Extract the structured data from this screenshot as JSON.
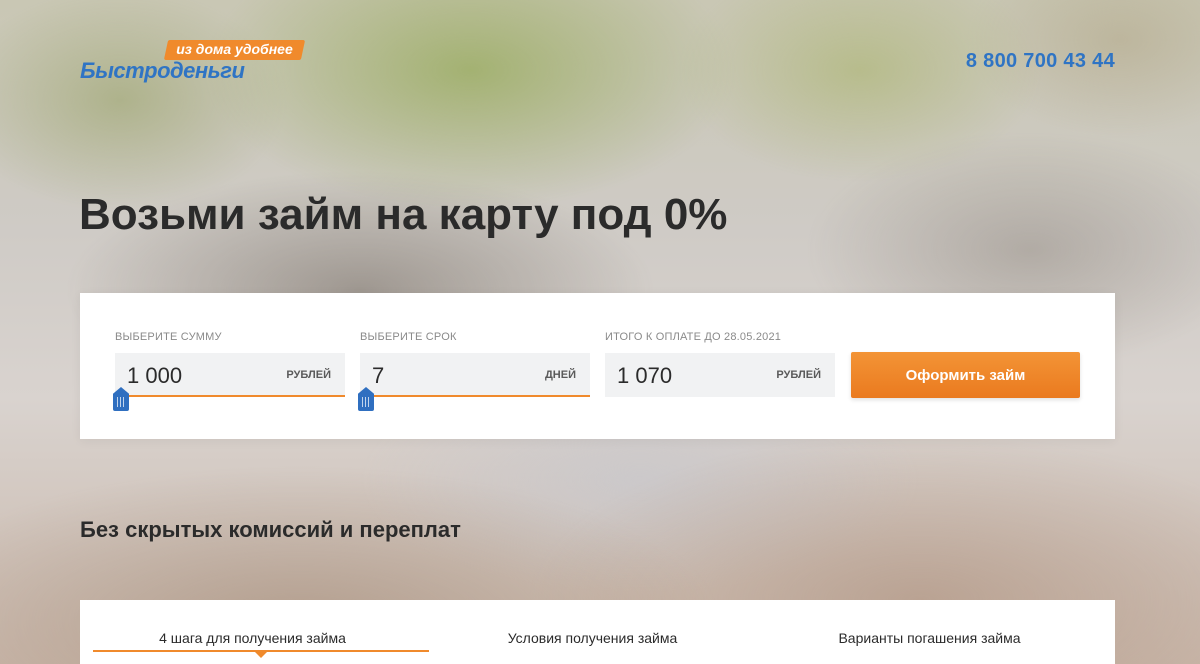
{
  "header": {
    "logo_tagline": "из дома удобнее",
    "logo_name": "Быстроденьги",
    "phone": "8 800 700 43 44"
  },
  "hero": {
    "title": "Возьми займ на карту под 0%"
  },
  "calculator": {
    "amount": {
      "label": "ВЫБЕРИТЕ СУММУ",
      "value": "1 000",
      "unit": "РУБЛЕЙ",
      "slider_level": 0
    },
    "term": {
      "label": "ВЫБЕРИТЕ СРОК",
      "value": "7",
      "unit": "ДНЕЙ",
      "slider_level": 0
    },
    "total": {
      "label": "ИТОГО К ОПЛАТЕ ДО 28.05.2021",
      "value": "1 070",
      "unit": "РУБЛЕЙ"
    },
    "submit_label": "Оформить займ"
  },
  "section": {
    "title": "Без скрытых комиссий и переплат",
    "tabs": [
      {
        "label": "4 шага для получения займа",
        "active": true
      },
      {
        "label": "Условия получения займа",
        "active": false
      },
      {
        "label": "Варианты погашения займа",
        "active": false
      }
    ]
  },
  "colors": {
    "brand_blue": "#2f74c4",
    "accent_orange": "#f08a2c"
  }
}
